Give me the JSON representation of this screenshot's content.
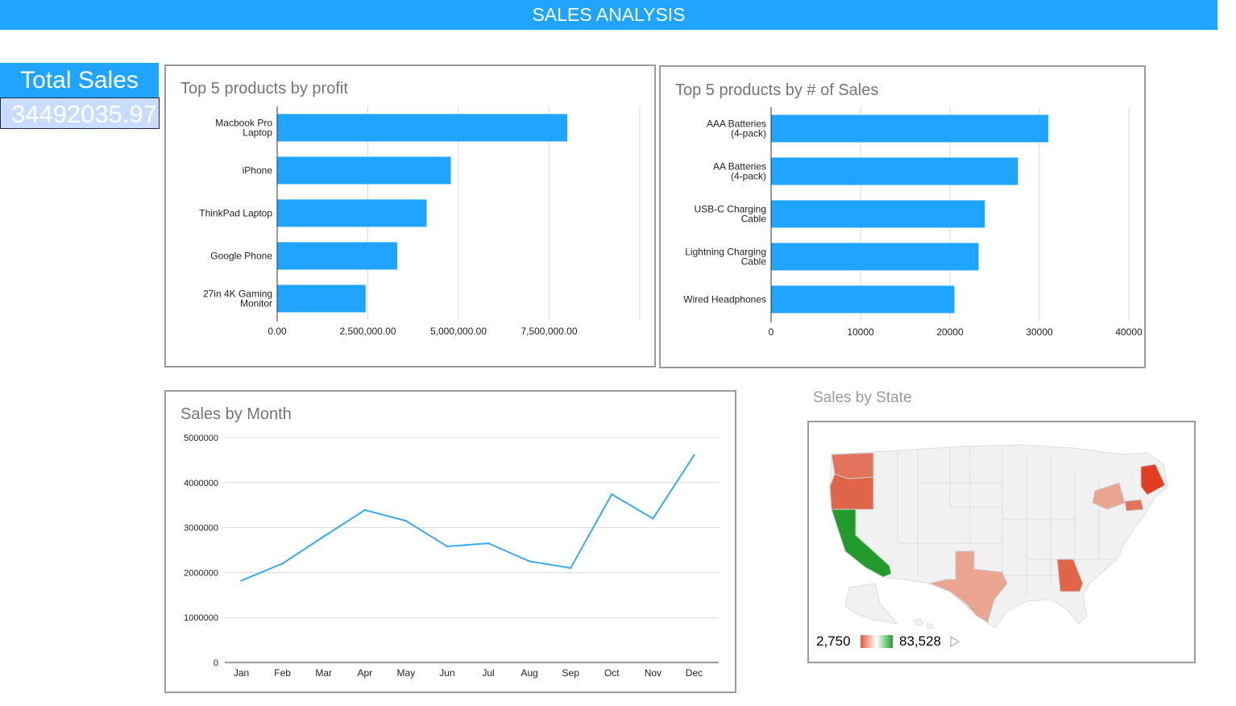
{
  "header": {
    "title": "SALES ANALYSIS"
  },
  "kpi": {
    "label": "Total Sales",
    "value": "34492035.97"
  },
  "charts": {
    "profit": {
      "title": "Top 5 products by profit"
    },
    "count": {
      "title": "Top 5 products by # of Sales"
    },
    "month": {
      "title": "Sales by Month"
    },
    "state": {
      "title": "Sales by State"
    }
  },
  "map_legend": {
    "min": "2,750",
    "max": "83,528"
  },
  "colors": {
    "accent": "#1fa5ff",
    "line": "#39a9f0",
    "high": "#22a12e",
    "low": "#e05a3f"
  },
  "chart_data": [
    {
      "id": "profit",
      "type": "bar",
      "orientation": "horizontal",
      "title": "Top 5 products by profit",
      "categories": [
        [
          "Macbook Pro",
          "Laptop"
        ],
        [
          "iPhone"
        ],
        [
          "ThinkPad Laptop"
        ],
        [
          "Google Phone"
        ],
        [
          "27in 4K Gaming",
          "Monitor"
        ]
      ],
      "values": [
        8000000,
        4790000,
        4120000,
        3310000,
        2440000
      ],
      "xlim": [
        0,
        10000000
      ],
      "xticks": [
        0,
        2500000,
        5000000,
        7500000
      ],
      "xtick_labels": [
        "0.00",
        "2,500,000.00",
        "5,000,000.00",
        "7,500,000.00"
      ]
    },
    {
      "id": "count",
      "type": "bar",
      "orientation": "horizontal",
      "title": "Top 5 products by # of Sales",
      "categories": [
        [
          "AAA Batteries",
          "(4-pack)"
        ],
        [
          "AA Batteries",
          "(4-pack)"
        ],
        [
          "USB-C Charging",
          "Cable"
        ],
        [
          "Lightning Charging",
          "Cable"
        ],
        [
          "Wired Headphones"
        ]
      ],
      "values": [
        31000,
        27600,
        23900,
        23200,
        20500
      ],
      "xlim": [
        0,
        40000
      ],
      "xticks": [
        0,
        10000,
        20000,
        30000,
        40000
      ],
      "xtick_labels": [
        "0",
        "10000",
        "20000",
        "30000",
        "40000"
      ]
    },
    {
      "id": "month",
      "type": "line",
      "title": "Sales by Month",
      "categories": [
        "Jan",
        "Feb",
        "Mar",
        "Apr",
        "May",
        "Jun",
        "Jul",
        "Aug",
        "Sep",
        "Oct",
        "Nov",
        "Dec"
      ],
      "values": [
        1820000,
        2200000,
        2800000,
        3390000,
        3150000,
        2580000,
        2650000,
        2250000,
        2100000,
        3740000,
        3200000,
        4610000
      ],
      "ylim": [
        0,
        5000000
      ],
      "yticks": [
        0,
        1000000,
        2000000,
        3000000,
        4000000,
        5000000
      ],
      "ytick_labels": [
        "0",
        "1000000",
        "2000000",
        "3000000",
        "4000000",
        "5000000"
      ]
    }
  ]
}
